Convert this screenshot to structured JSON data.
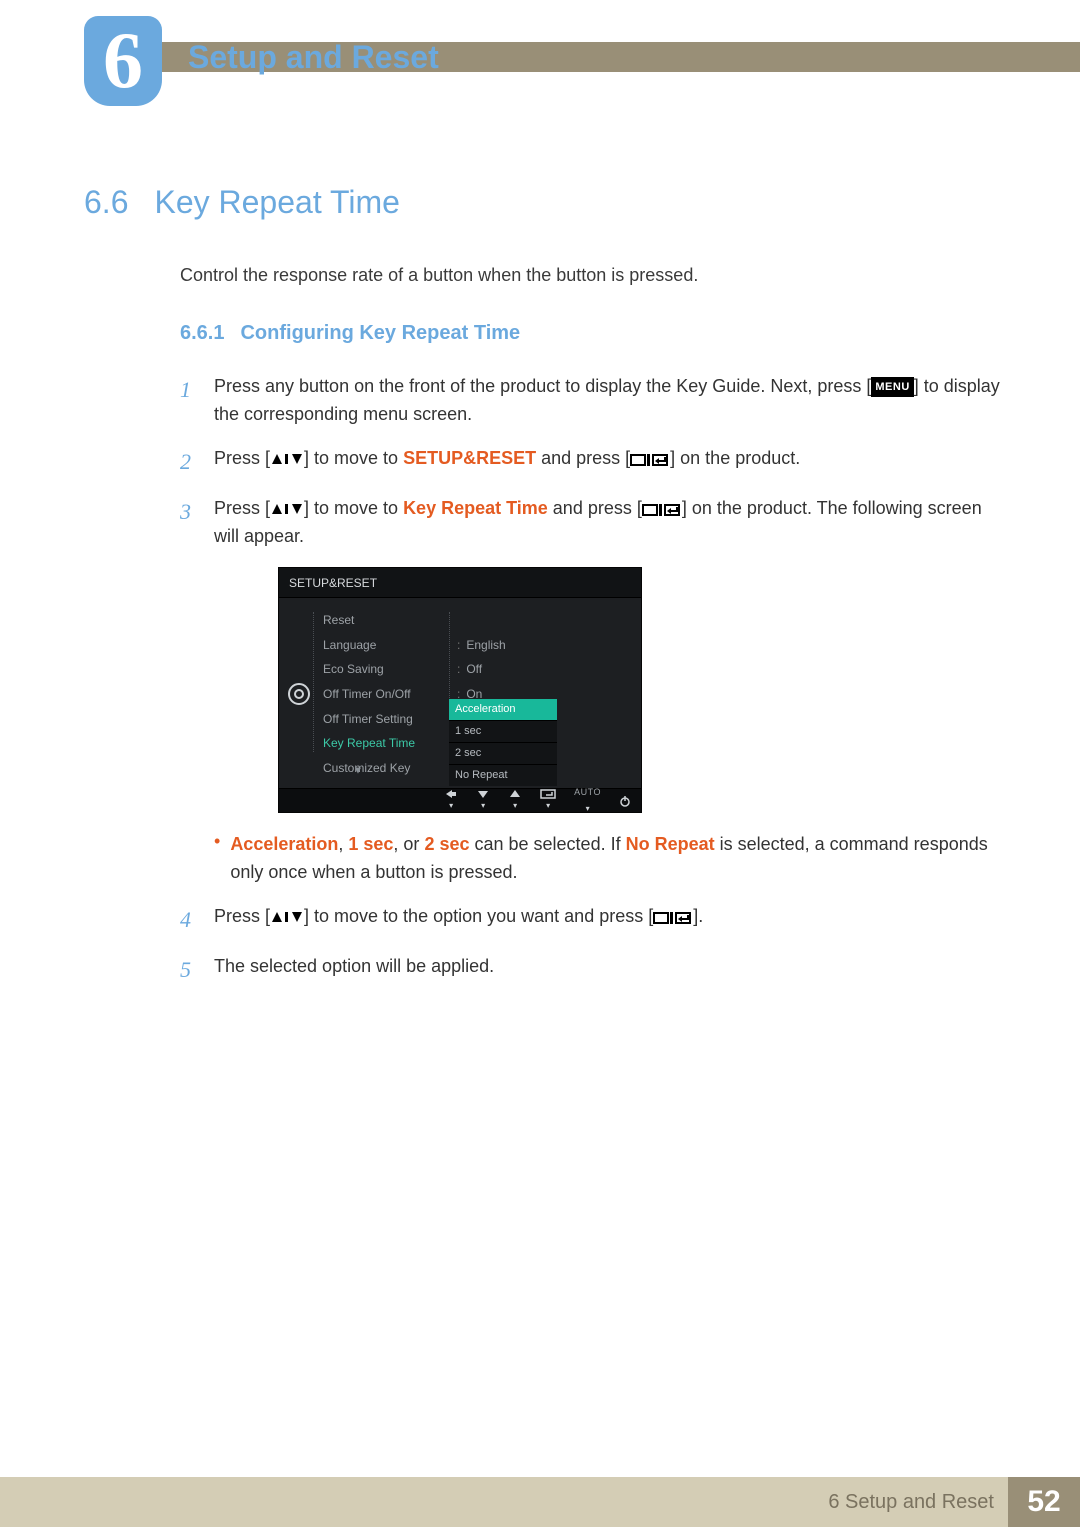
{
  "chapter": {
    "number": "6",
    "title": "Setup and Reset"
  },
  "section": {
    "num": "6.6",
    "title": "Key Repeat Time",
    "intro": "Control the response rate of a button when the button is pressed."
  },
  "subsection": {
    "num": "6.6.1",
    "title": "Configuring Key Repeat Time"
  },
  "steps": {
    "s1a": "Press any button on the front of the product to display the Key Guide. Next, press [",
    "s1b": "] to display the corresponding menu screen.",
    "menu_badge": "MENU",
    "s2a": "Press [",
    "s2b": "] to move to ",
    "s2c": " and press [",
    "s2d": "] on the product.",
    "s2_target": "SETUP&RESET",
    "s3a": "Press [",
    "s3b": "] to move to ",
    "s3c": " and press [",
    "s3d": "] on the product. The following screen will appear.",
    "s3_target": "Key Repeat Time",
    "bullet_parts": {
      "a": "Acceleration",
      "b": ", ",
      "c": "1 sec",
      "d": ", or ",
      "e": "2 sec",
      "f": " can be selected. If ",
      "g": "No Repeat",
      "h": " is selected, a command responds only once when a button is pressed."
    },
    "s4a": "Press [",
    "s4b": "] to move to the option you want and press [",
    "s4c": "].",
    "s5": "The selected option will be applied."
  },
  "osd": {
    "title": "SETUP&RESET",
    "menu": [
      "Reset",
      "Language",
      "Eco Saving",
      "Off Timer On/Off",
      "Off Timer Setting",
      "Key Repeat Time",
      "Customized Key"
    ],
    "selected_index": 5,
    "values": {
      "Language": "English",
      "Eco Saving": "Off",
      "Off Timer On/Off": "On"
    },
    "dropdown": [
      "Acceleration",
      "1 sec",
      "2 sec",
      "No Repeat"
    ],
    "bottom_auto": "AUTO"
  },
  "footer": {
    "label": "6 Setup and Reset",
    "page": "52"
  }
}
